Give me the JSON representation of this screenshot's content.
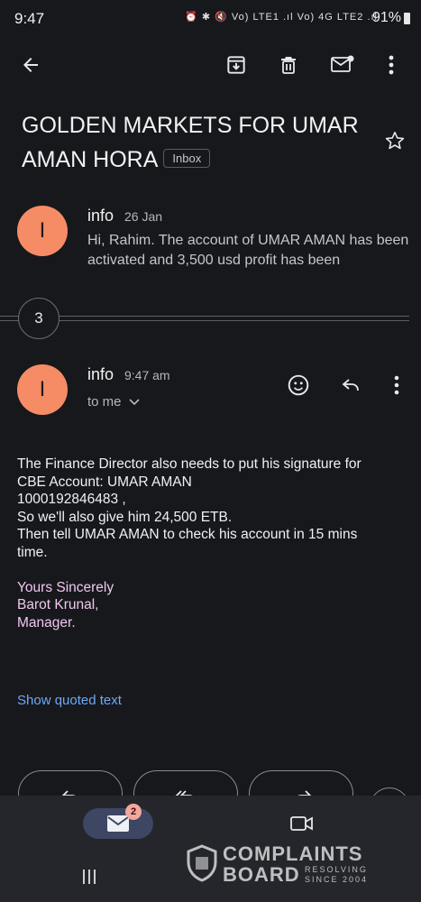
{
  "status_bar": {
    "time": "9:47",
    "icons_text": "⏰ ✱ 🔇 Vo) LTE1 .ıl Vo) 4G LTE2 .ıl",
    "battery": "91%"
  },
  "toolbar": {
    "back": "arrow-left-icon",
    "archive": "archive-icon",
    "delete": "trash-icon",
    "mark_unread": "mail-unread-icon",
    "more": "more-vert-icon"
  },
  "thread": {
    "subject": "GOLDEN MARKETS FOR UMAR AMAN HORA",
    "label": "Inbox"
  },
  "message_1": {
    "avatar_letter": "I",
    "sender": "info",
    "date": "26 Jan",
    "snippet": "Hi, Rahim. The account of UMAR AMAN has been activated and 3,500 usd profit has been"
  },
  "collapsed": {
    "count": "3"
  },
  "message_2": {
    "avatar_letter": "I",
    "sender": "info",
    "time": "9:47 am",
    "recipient": "to me",
    "body_lines": [
      "The Finance Director also needs to put his signature for",
      "CBE Account: UMAR AMAN",
      "1000192846483 ,",
      "So we'll also give him 24,500 ETB.",
      "Then tell UMAR AMAN to check his account in 15 mins",
      "time.",
      "",
      "Yours Sincerely",
      "Barot Krunal,",
      "Manager."
    ],
    "show_quoted": "Show quoted text"
  },
  "bottom_nav": {
    "mail_badge": "2"
  },
  "watermark": {
    "line1": "COMPLAINTS",
    "line2": "BOARD",
    "sub1": "RESOLVING",
    "sub2": "SINCE 2004"
  },
  "colors": {
    "background": "#17181c",
    "avatar": "#f58c66",
    "link": "#6ea8f8",
    "signature": "#f0c7f0",
    "nav_pill": "#3d4663"
  }
}
